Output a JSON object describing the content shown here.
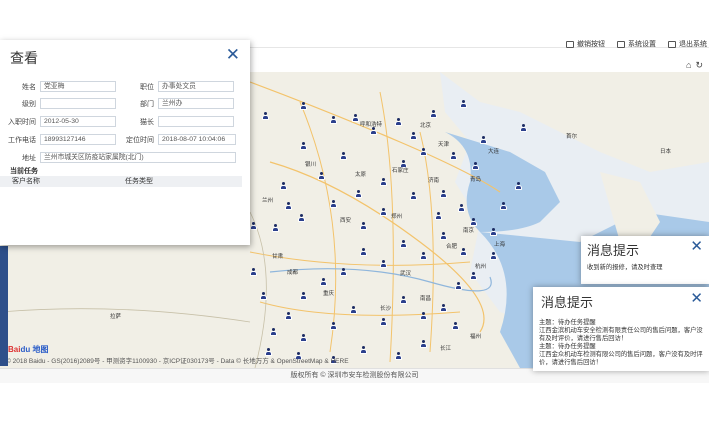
{
  "header": {
    "items": [
      "撤销按钮",
      "系统设置",
      "退出系统"
    ]
  },
  "view_panel": {
    "title": "查看",
    "fields": [
      {
        "label": "姓名",
        "value": "党亚梅"
      },
      {
        "label": "职位",
        "value": "办事处文员"
      },
      {
        "label": "级别",
        "value": ""
      },
      {
        "label": "部门",
        "value": "兰州办"
      },
      {
        "label": "入职时间",
        "value": "2012-05-30"
      },
      {
        "label": "猫长",
        "value": ""
      },
      {
        "label": "工作电话",
        "value": "18993127146"
      },
      {
        "label": "定位时间",
        "value": "2018-08-07 10:04:06"
      },
      {
        "label": "地址",
        "value": "兰州市城关区防疫站家属院(北门)"
      }
    ],
    "section_title": "当前任务",
    "columns": [
      "客户名称",
      "任务类型"
    ]
  },
  "map": {
    "cities": [
      {
        "name": "北京"
      },
      {
        "name": "天津"
      },
      {
        "name": "石家庄"
      },
      {
        "name": "太原"
      },
      {
        "name": "济南"
      },
      {
        "name": "郑州"
      },
      {
        "name": "西安"
      },
      {
        "name": "武汉"
      },
      {
        "name": "南京"
      },
      {
        "name": "合肥"
      },
      {
        "name": "兰州"
      },
      {
        "name": "银川"
      },
      {
        "name": "呼和浩特"
      },
      {
        "name": "大连"
      },
      {
        "name": "青岛"
      },
      {
        "name": "成都"
      },
      {
        "name": "重庆"
      },
      {
        "name": "长沙"
      },
      {
        "name": "南昌"
      },
      {
        "name": "杭州"
      },
      {
        "name": "上海"
      },
      {
        "name": "首尔"
      },
      {
        "name": "日本"
      },
      {
        "name": "拉萨"
      },
      {
        "name": "青海"
      },
      {
        "name": "甘肃"
      },
      {
        "name": "长江"
      },
      {
        "name": "福州"
      }
    ],
    "copyright": "© 2018 Baidu - GS(2016)2089号 - 甲测资字1100930 - 京ICP证030173号 - Data © 长地万方 & OpenStreetMap & HERE",
    "logo_main": "Bai",
    "logo_accent": "du 地图"
  },
  "footer": "版权所有 © 深圳市安车检测股份有限公司",
  "toolbar_icons": [
    "⌂",
    "↻"
  ],
  "notice_small": {
    "title": "消息提示",
    "text": "收到新的报修，请及时查理"
  },
  "notice_large": {
    "title": "消息提示",
    "lines": [
      "主题：待办任务提醒",
      "江西金滨机动车安全检测有限责任公司的售后问题，客户没有及时评价，请进行售后回访！",
      "主题：待办任务提醒",
      "江西金众机动车检测有限公司的售后问题，客户没有及时评价，请进行售后回访！"
    ]
  },
  "colors": {
    "accent": "#2b5b99",
    "marker": "#2b3f8c",
    "stripe": "#2e4f8a"
  }
}
